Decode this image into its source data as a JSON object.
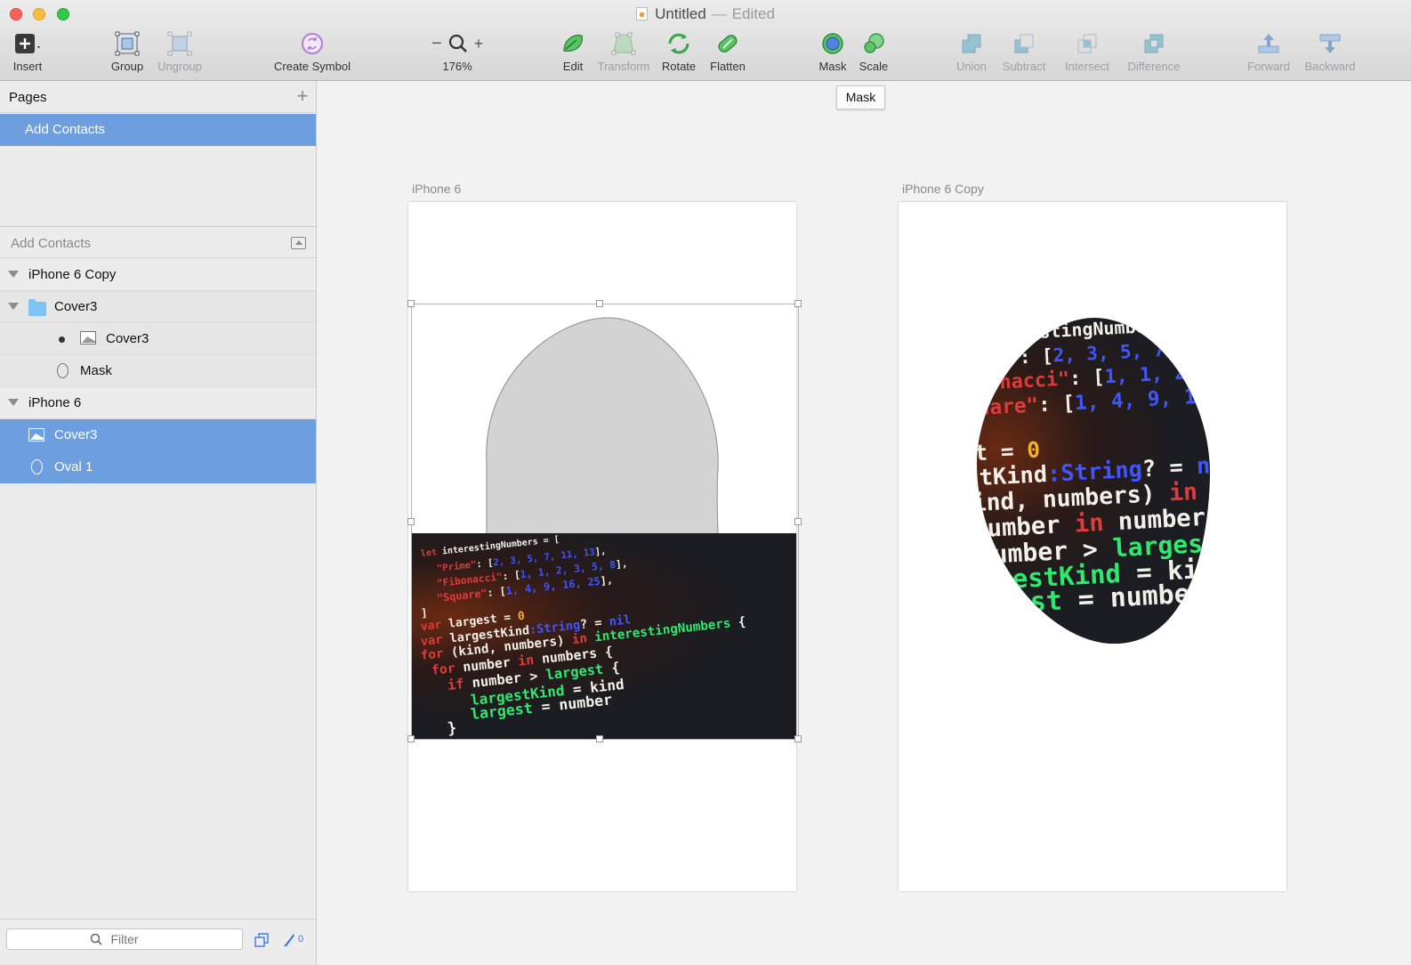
{
  "window": {
    "title": "Untitled",
    "separator": "—",
    "status": "Edited"
  },
  "toolbar": {
    "insert": "Insert",
    "group": "Group",
    "ungroup": "Ungroup",
    "create_symbol": "Create Symbol",
    "zoom": "176%",
    "edit": "Edit",
    "transform": "Transform",
    "rotate": "Rotate",
    "flatten": "Flatten",
    "mask": "Mask",
    "scale": "Scale",
    "union": "Union",
    "subtract": "Subtract",
    "intersect": "Intersect",
    "difference": "Difference",
    "forward": "Forward",
    "backward": "Backward"
  },
  "tooltip": "Mask",
  "pages": {
    "title": "Pages",
    "items": [
      "Add Contacts"
    ]
  },
  "layers": {
    "title": "Add Contacts",
    "items": [
      {
        "label": "iPhone 6 Copy",
        "kind": "artboard",
        "selected": false
      },
      {
        "label": "Cover3",
        "kind": "group",
        "selected": false
      },
      {
        "label": "Cover3",
        "kind": "image",
        "selected": false
      },
      {
        "label": "Mask",
        "kind": "oval",
        "selected": false
      },
      {
        "label": "iPhone 6",
        "kind": "artboard",
        "selected": false
      },
      {
        "label": "Cover3",
        "kind": "image",
        "selected": true
      },
      {
        "label": "Oval 1",
        "kind": "oval",
        "selected": true
      }
    ]
  },
  "filter": {
    "placeholder": "Filter",
    "slice_count": "0"
  },
  "canvas": {
    "artboards": [
      "iPhone 6",
      "iPhone 6 Copy"
    ]
  },
  "code_image": {
    "lines": [
      {
        "parts": [
          [
            "let ",
            "red"
          ],
          [
            "interestingNumbers",
            "white"
          ],
          [
            " = [",
            "white"
          ]
        ]
      },
      {
        "parts": [
          [
            "\"Prime\"",
            "red"
          ],
          [
            ": [",
            "white"
          ],
          [
            "2, 3, 5, 7, 11, 13",
            "blue"
          ],
          [
            "],",
            "white"
          ]
        ]
      },
      {
        "parts": [
          [
            "\"Fibonacci\"",
            "red"
          ],
          [
            ": [",
            "white"
          ],
          [
            "1, 1, 2, 3, 5, 8",
            "blue"
          ],
          [
            "],",
            "white"
          ]
        ]
      },
      {
        "parts": [
          [
            "\"Square\"",
            "red"
          ],
          [
            ": [",
            "white"
          ],
          [
            "1, 4, 9, 16, 25",
            "blue"
          ],
          [
            "],",
            "white"
          ]
        ]
      },
      {
        "parts": [
          [
            "]",
            "white"
          ]
        ]
      },
      {
        "parts": [
          [
            "var ",
            "red"
          ],
          [
            "largest = ",
            "white"
          ],
          [
            "0",
            "orange"
          ]
        ]
      },
      {
        "parts": [
          [
            "var ",
            "red"
          ],
          [
            "largestKind",
            "white"
          ],
          [
            ":String",
            "blue"
          ],
          [
            "? = ",
            "white"
          ],
          [
            "nil",
            "blue"
          ]
        ]
      },
      {
        "parts": [
          [
            "for ",
            "red"
          ],
          [
            "(kind, numbers) ",
            "white"
          ],
          [
            "in ",
            "red"
          ],
          [
            "interestingNumbers",
            "green"
          ],
          [
            " {",
            "white"
          ]
        ]
      },
      {
        "parts": [
          [
            "for ",
            "red"
          ],
          [
            "number ",
            "white"
          ],
          [
            "in ",
            "red"
          ],
          [
            "numbers",
            "white"
          ],
          [
            " {",
            "white"
          ]
        ]
      },
      {
        "parts": [
          [
            "if ",
            "red"
          ],
          [
            "number > ",
            "white"
          ],
          [
            "largest",
            "green"
          ],
          [
            " {",
            "white"
          ]
        ]
      },
      {
        "parts": [
          [
            "largestKind",
            "green"
          ],
          [
            " = kind",
            "white"
          ]
        ]
      },
      {
        "parts": [
          [
            "largest",
            "green"
          ],
          [
            " = number",
            "white"
          ]
        ]
      },
      {
        "parts": [
          [
            "}",
            "white"
          ]
        ]
      }
    ]
  }
}
